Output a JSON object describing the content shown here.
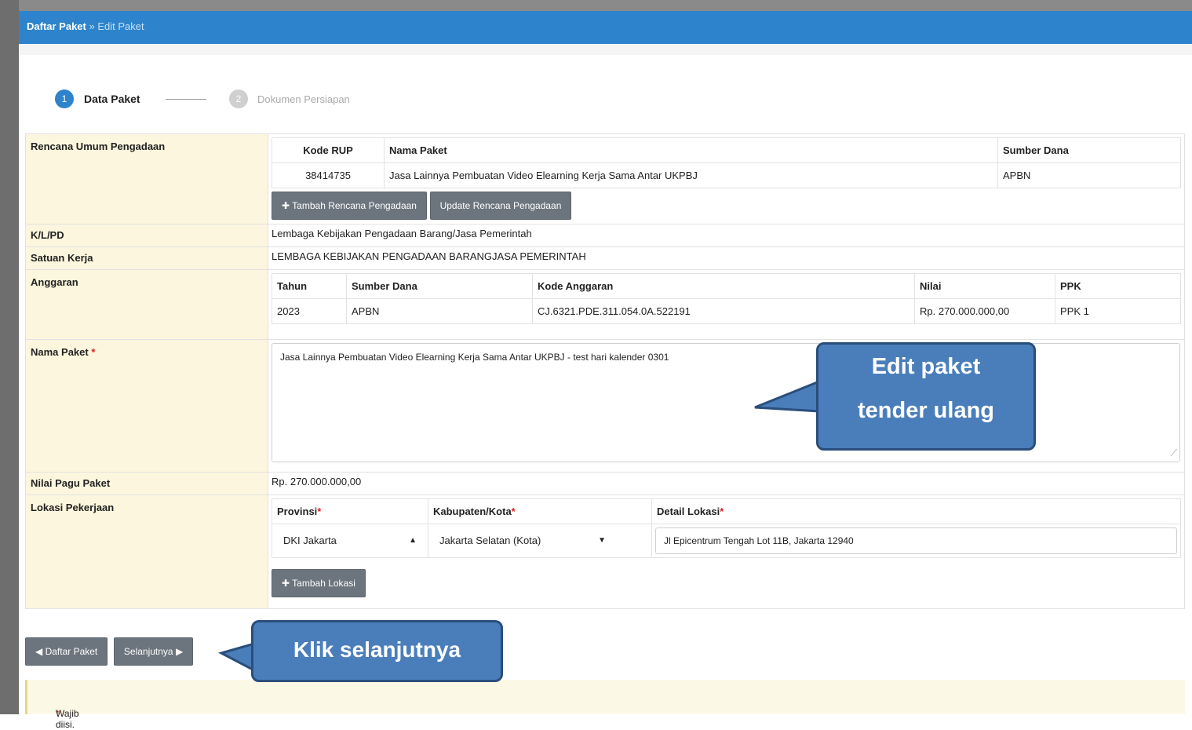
{
  "breadcrumb": {
    "root": "Daftar Paket",
    "separator": "»",
    "current": "Edit Paket"
  },
  "steps": [
    {
      "number": "1",
      "label": "Data Paket"
    },
    {
      "number": "2",
      "label": "Dokumen Persiapan"
    }
  ],
  "rup": {
    "label": "Rencana Umum Pengadaan",
    "headers": {
      "kode": "Kode RUP",
      "nama": "Nama Paket",
      "sumber": "Sumber Dana"
    },
    "row": {
      "kode": "38414735",
      "nama": "Jasa Lainnya Pembuatan Video Elearning Kerja Sama Antar UKPBJ",
      "sumber": "APBN"
    },
    "btn_tambah": "Tambah Rencana Pengadaan",
    "btn_update": "Update Rencana Pengadaan"
  },
  "klpd": {
    "label": "K/L/PD",
    "value": "Lembaga Kebijakan Pengadaan Barang/Jasa Pemerintah"
  },
  "satker": {
    "label": "Satuan Kerja",
    "value": "LEMBAGA KEBIJAKAN PENGADAAN BARANGJASA PEMERINTAH"
  },
  "anggaran": {
    "label": "Anggaran",
    "headers": {
      "tahun": "Tahun",
      "sumber": "Sumber Dana",
      "kode": "Kode Anggaran",
      "nilai": "Nilai",
      "ppk": "PPK"
    },
    "row": {
      "tahun": "2023",
      "sumber": "APBN",
      "kode": "CJ.6321.PDE.311.054.0A.522191",
      "nilai": "Rp. 270.000.000,00",
      "ppk": "PPK 1"
    }
  },
  "nama_paket": {
    "label": "Nama Paket",
    "required_mark": "*",
    "value": "Jasa Lainnya Pembuatan Video Elearning Kerja Sama Antar UKPBJ - test hari kalender 0301"
  },
  "pagu": {
    "label": "Nilai Pagu Paket",
    "value": "Rp. 270.000.000,00"
  },
  "lokasi": {
    "label": "Lokasi Pekerjaan",
    "headers": {
      "provinsi": "Provinsi",
      "kota": "Kabupaten/Kota",
      "detail": "Detail Lokasi"
    },
    "required_mark": "*",
    "provinsi": "DKI Jakarta",
    "kota": "Jakarta Selatan (Kota)",
    "detail": "Jl Epicentrum Tengah Lot 11B, Jakarta 12940",
    "btn_tambah": "Tambah Lokasi"
  },
  "buttons": {
    "daftar": "Daftar Paket",
    "selanjutnya": "Selanjutnya"
  },
  "notice": {
    "mark": "*",
    "text": "Wajib diisi."
  },
  "callouts": {
    "edit_line1": "Edit paket",
    "edit_line2": "tender ulang",
    "next": "Klik selanjutnya"
  },
  "colors": {
    "header_blue": "#2d84cc",
    "label_bg": "#fbf6dd",
    "button_gray": "#6c757d",
    "callout_fill": "#4a7ebb",
    "required_red": "#dd2222"
  }
}
